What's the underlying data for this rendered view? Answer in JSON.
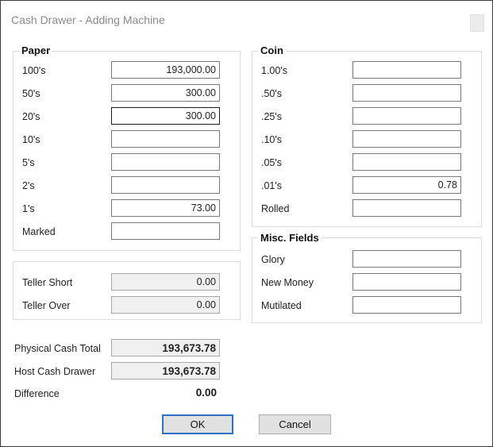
{
  "window": {
    "title": "Cash Drawer - Adding Machine"
  },
  "paper": {
    "title": "Paper",
    "rows": [
      {
        "label": "100's",
        "value": "193,000.00"
      },
      {
        "label": "50's",
        "value": "300.00"
      },
      {
        "label": "20's",
        "value": "300.00"
      },
      {
        "label": "10's",
        "value": ""
      },
      {
        "label": "5's",
        "value": ""
      },
      {
        "label": "2's",
        "value": ""
      },
      {
        "label": "1's",
        "value": "73.00"
      },
      {
        "label": "Marked",
        "value": ""
      }
    ]
  },
  "coin": {
    "title": "Coin",
    "rows": [
      {
        "label": "1.00's",
        "value": ""
      },
      {
        "label": ".50's",
        "value": ""
      },
      {
        "label": ".25's",
        "value": ""
      },
      {
        "label": ".10's",
        "value": ""
      },
      {
        "label": ".05's",
        "value": ""
      },
      {
        "label": ".01's",
        "value": "0.78"
      },
      {
        "label": "Rolled",
        "value": ""
      }
    ]
  },
  "teller": {
    "rows": [
      {
        "label": "Teller Short",
        "value": "0.00"
      },
      {
        "label": "Teller Over",
        "value": "0.00"
      }
    ]
  },
  "misc": {
    "title": "Misc. Fields",
    "rows": [
      {
        "label": "Glory",
        "value": ""
      },
      {
        "label": "New Money",
        "value": ""
      },
      {
        "label": "Mutilated",
        "value": ""
      }
    ]
  },
  "totals": {
    "physical_label": "Physical Cash Total",
    "physical_value": "193,673.78",
    "host_label": "Host Cash Drawer",
    "host_value": "193,673.78",
    "difference_label": "Difference",
    "difference_value": "0.00"
  },
  "buttons": {
    "ok": "OK",
    "cancel": "Cancel"
  }
}
